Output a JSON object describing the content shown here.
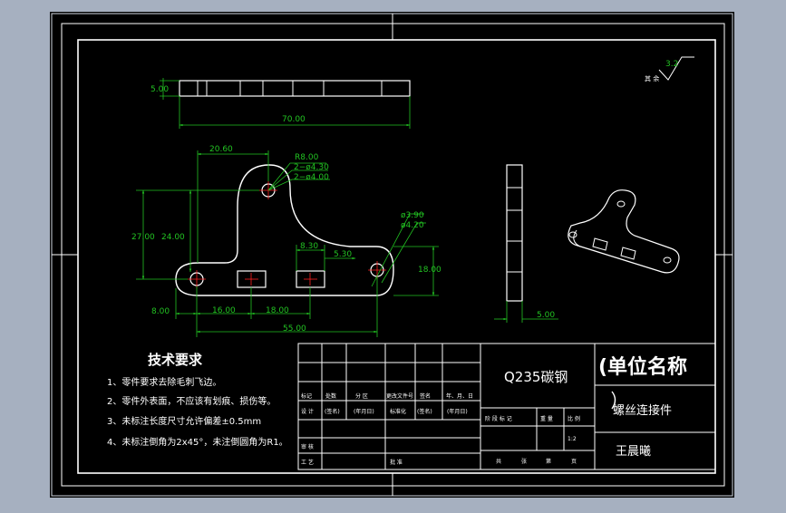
{
  "colors": {
    "background": "#a6b0c0",
    "paper": "#000000",
    "line": "#ffffff",
    "dimension": "#22c222",
    "center": "#ff2020"
  },
  "dimensions": {
    "top_thickness": "5.00",
    "top_length": "70.00",
    "width_20_60": "20.60",
    "radius_r8": "R8.00",
    "holes_4_30": "2−ø4.30",
    "holes_4_00": "2−ø4.00",
    "height_27": "27.00",
    "height_24": "24.00",
    "hole_3_90": "ø3.90",
    "hole_4_20": "ø4.20",
    "slot_8_30": "8.30",
    "slot_5_30": "5.30",
    "height_18": "18.00",
    "offset_8": "8.00",
    "span_16": "16.00",
    "span_18": "18.00",
    "total_55": "55.00",
    "side_thickness": "5.00"
  },
  "roughness": {
    "label": "其 余",
    "value": "3.2"
  },
  "tech_requirements": {
    "title": "技术要求",
    "items": [
      "1、零件要求去除毛刺飞边。",
      "2、零件外表面，不应该有划痕、损伤等。",
      "3、未标注长度尺寸允许偏差±0.5mm",
      "4、未标注倒角为2x45°，未注倒圆角为R1。"
    ]
  },
  "title_block": {
    "material": "Q235碳钢",
    "unit": "(单位名称",
    "part_name": "螺丝连接件",
    "designer": "王晨曦",
    "scale": "1:2",
    "r1": {
      "c0": "标记",
      "c1": "处数",
      "c2": "分 区",
      "c3": "更改文件号",
      "c4": "签名",
      "c5": "年、月、日"
    },
    "r2": {
      "c0": "设 计",
      "c1": "(签名)",
      "c2": "(年月日)",
      "c3": "标准化",
      "c4": "(签名)",
      "c5": "(年月日)"
    },
    "r3": {
      "c0": "审 核"
    },
    "r4": {
      "c0": "工 艺",
      "c1": "批 准"
    },
    "mid": {
      "a": "阶 段 标 记",
      "b": "重 量",
      "c": "比 例"
    },
    "sheet": {
      "a": "共",
      "b": "张",
      "c": "第",
      "d": "页"
    }
  }
}
